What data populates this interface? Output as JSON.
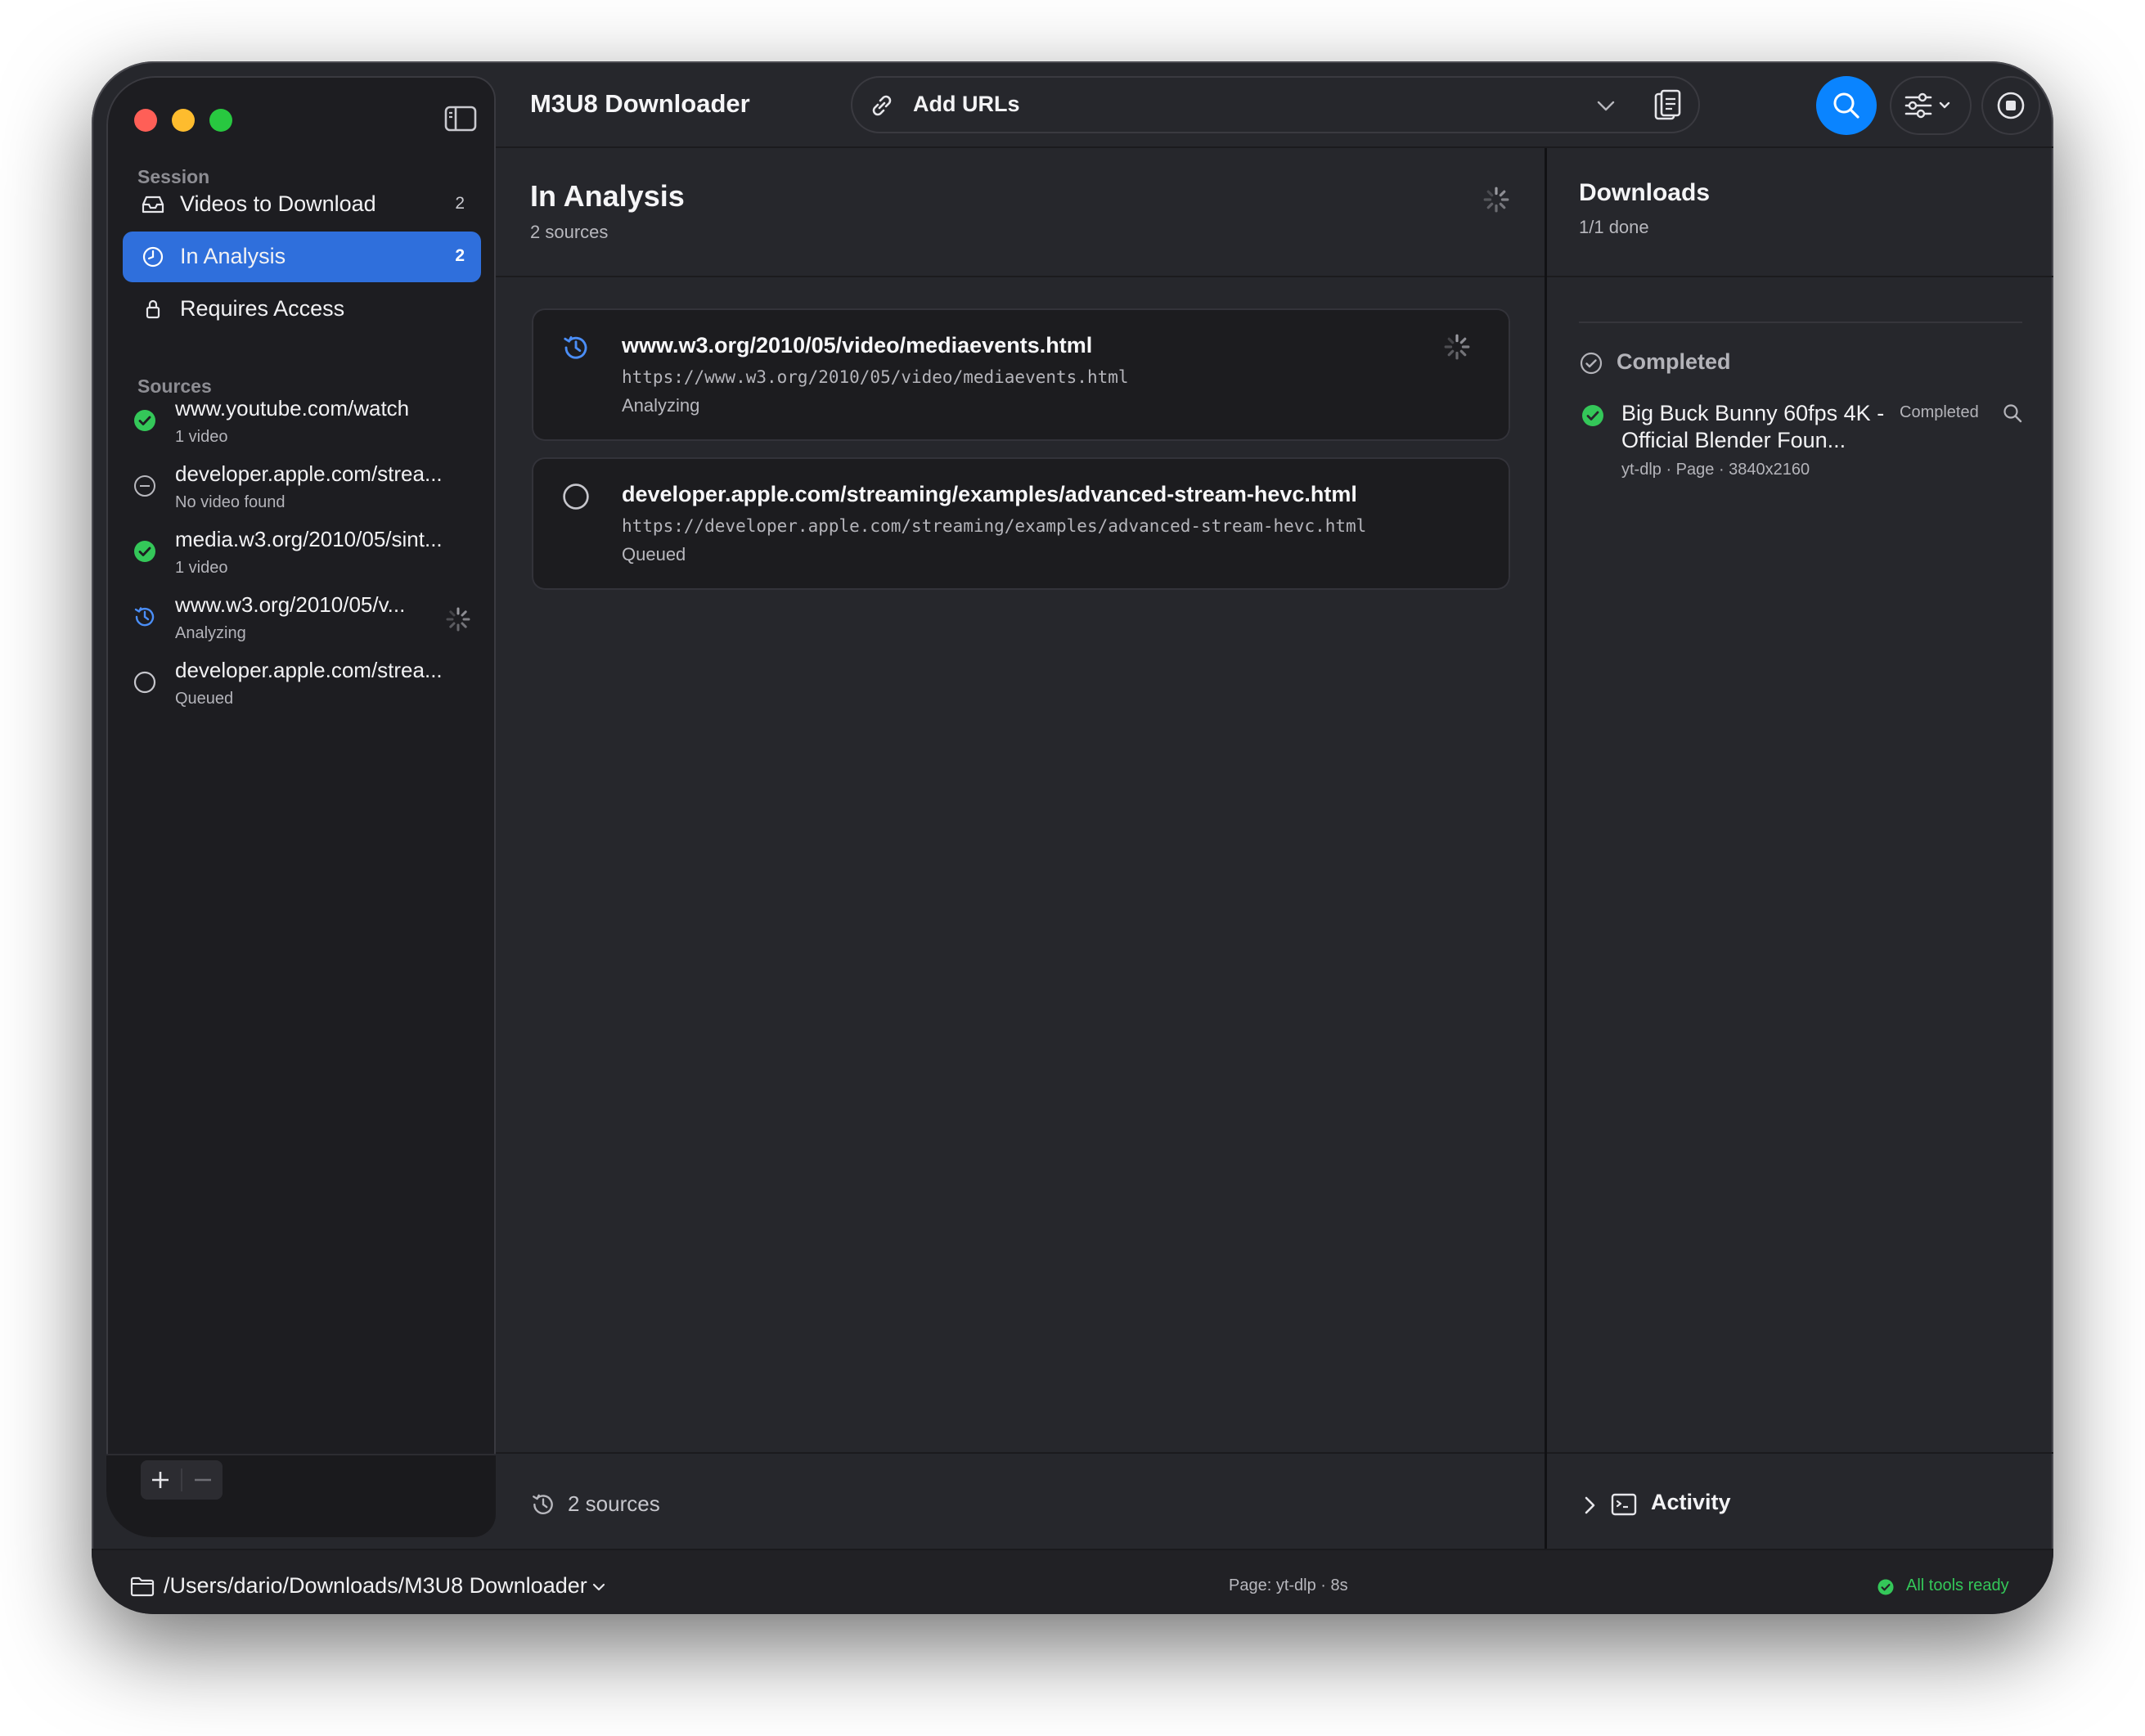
{
  "app": {
    "title": "M3U8 Downloader"
  },
  "toolbar": {
    "url_field_label": "Add URLs"
  },
  "sidebar": {
    "session_label": "Session",
    "session_items": [
      {
        "label": "Videos to Download",
        "count": "2",
        "icon": "tray-icon"
      },
      {
        "label": "In Analysis",
        "count": "2",
        "icon": "clock-icon",
        "selected": true
      },
      {
        "label": "Requires Access",
        "count": "",
        "icon": "lock-icon"
      }
    ],
    "sources_label": "Sources",
    "sources": [
      {
        "title": "www.youtube.com/watch",
        "subtitle": "1 video",
        "state": "success"
      },
      {
        "title": "developer.apple.com/strea...",
        "subtitle": "No video found",
        "state": "none"
      },
      {
        "title": "media.w3.org/2010/05/sint...",
        "subtitle": "1 video",
        "state": "success"
      },
      {
        "title": "www.w3.org/2010/05/v...",
        "subtitle": "Analyzing",
        "state": "analyzing"
      },
      {
        "title": "developer.apple.com/strea...",
        "subtitle": "Queued",
        "state": "queued"
      }
    ]
  },
  "analysis": {
    "title": "In Analysis",
    "subtitle": "2 sources",
    "cards": [
      {
        "title": "www.w3.org/2010/05/video/mediaevents.html",
        "url": "https://www.w3.org/2010/05/video/mediaevents.html",
        "status": "Analyzing",
        "state": "analyzing"
      },
      {
        "title": "developer.apple.com/streaming/examples/advanced-stream-hevc.html",
        "url": "https://developer.apple.com/streaming/examples/advanced-stream-hevc.html",
        "status": "Queued",
        "state": "queued"
      }
    ],
    "footer_label": "2 sources"
  },
  "downloads": {
    "title": "Downloads",
    "subtitle": "1/1 done",
    "section_label": "Completed",
    "items": [
      {
        "title": "Big Buck Bunny 60fps 4K - Official Blender Foun...",
        "meta": "yt-dlp · Page · 3840x2160",
        "status": "Completed"
      }
    ],
    "activity_label": "Activity"
  },
  "status_bar": {
    "path": "/Users/dario/Downloads/M3U8 Downloader",
    "center": "Page: yt-dlp · 8s",
    "ready": "All tools ready"
  },
  "colors": {
    "accent": "#0a84ff",
    "selection": "#2f6fdc",
    "success": "#34c759",
    "analyzing": "#4b8ef7"
  }
}
